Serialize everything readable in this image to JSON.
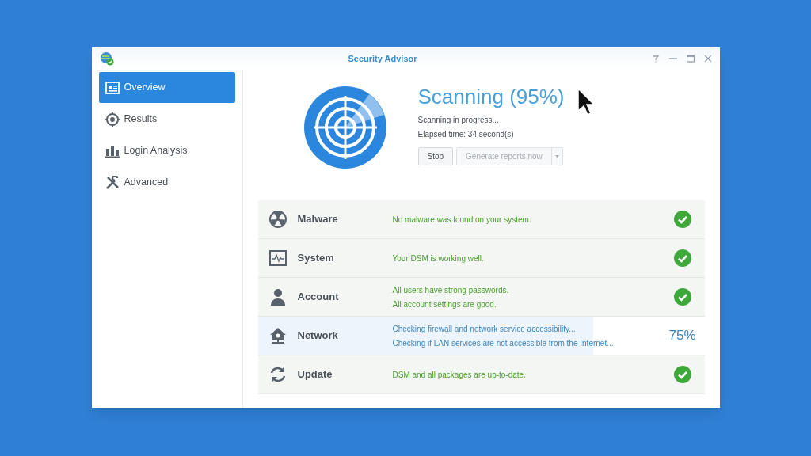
{
  "window": {
    "title": "Security Advisor"
  },
  "sidebar": {
    "items": [
      {
        "label": "Overview",
        "selected": true
      },
      {
        "label": "Results",
        "selected": false
      },
      {
        "label": "Login Analysis",
        "selected": false
      },
      {
        "label": "Advanced",
        "selected": false
      }
    ]
  },
  "scan": {
    "title": "Scanning (95%)",
    "status": "Scanning in progress...",
    "elapsed": "Elapsed time: 34 second(s)",
    "buttons": {
      "stop": "Stop",
      "generate": "Generate reports now",
      "generate_disabled": true
    }
  },
  "checks": [
    {
      "name": "Malware",
      "kind": "done",
      "messages": [
        "No malware was found on your system."
      ]
    },
    {
      "name": "System",
      "kind": "done",
      "messages": [
        "Your DSM is working well."
      ]
    },
    {
      "name": "Account",
      "kind": "done",
      "messages": [
        "All users have strong passwords.",
        "All account settings are good."
      ]
    },
    {
      "name": "Network",
      "kind": "progress",
      "level": 0.75,
      "reading": "75%",
      "messages": [
        "Checking firewall and network service accessibility...",
        "Checking if LAN services are not accessible from the Internet..."
      ]
    },
    {
      "name": "Update",
      "kind": "done",
      "messages": [
        "DSM and all packages are up-to-date."
      ]
    }
  ]
}
